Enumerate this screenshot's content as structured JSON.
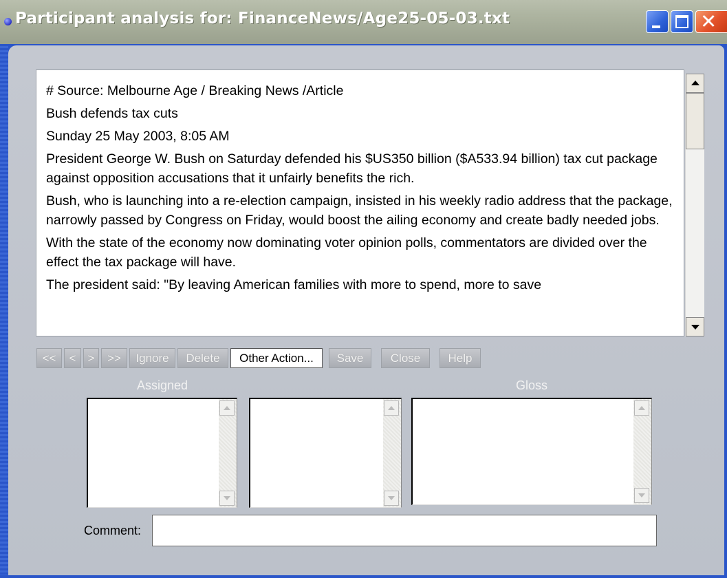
{
  "window": {
    "title": "Participant analysis for: FinanceNews/Age25-05-03.txt"
  },
  "document": {
    "paragraphs": [
      "# Source: Melbourne Age / Breaking News /Article",
      "Bush defends tax cuts",
      "Sunday 25 May 2003, 8:05 AM",
      "President George W. Bush on Saturday defended his $US350 billion ($A533.94 billion) tax cut package against opposition accusations that it unfairly benefits the rich.",
      "Bush, who is launching into a re-election campaign, insisted in his weekly radio address that the package, narrowly passed by Congress on Friday, would boost the ailing economy and create badly needed jobs.",
      "With the state of the economy now dominating voter opinion polls, commentators are divided over the effect the tax package will have.",
      "The president said: \"By leaving American families with more to spend, more to save"
    ]
  },
  "toolbar": {
    "first": "<<",
    "prev": "<",
    "next": ">",
    "last": ">>",
    "ignore": "Ignore",
    "delete": "Delete",
    "other_action": "Other Action...",
    "save": "Save",
    "close": "Close",
    "help": "Help"
  },
  "lists": {
    "assigned_header": "Assigned",
    "gloss_header": "Gloss"
  },
  "comment": {
    "label": "Comment:",
    "value": ""
  },
  "icons": {
    "title": "window-dot-icon",
    "minimize": "minimize-icon",
    "maximize": "maximize-icon",
    "close": "close-icon",
    "scroll_up": "scroll-up-arrow-icon",
    "scroll_down": "scroll-down-arrow-icon"
  }
}
